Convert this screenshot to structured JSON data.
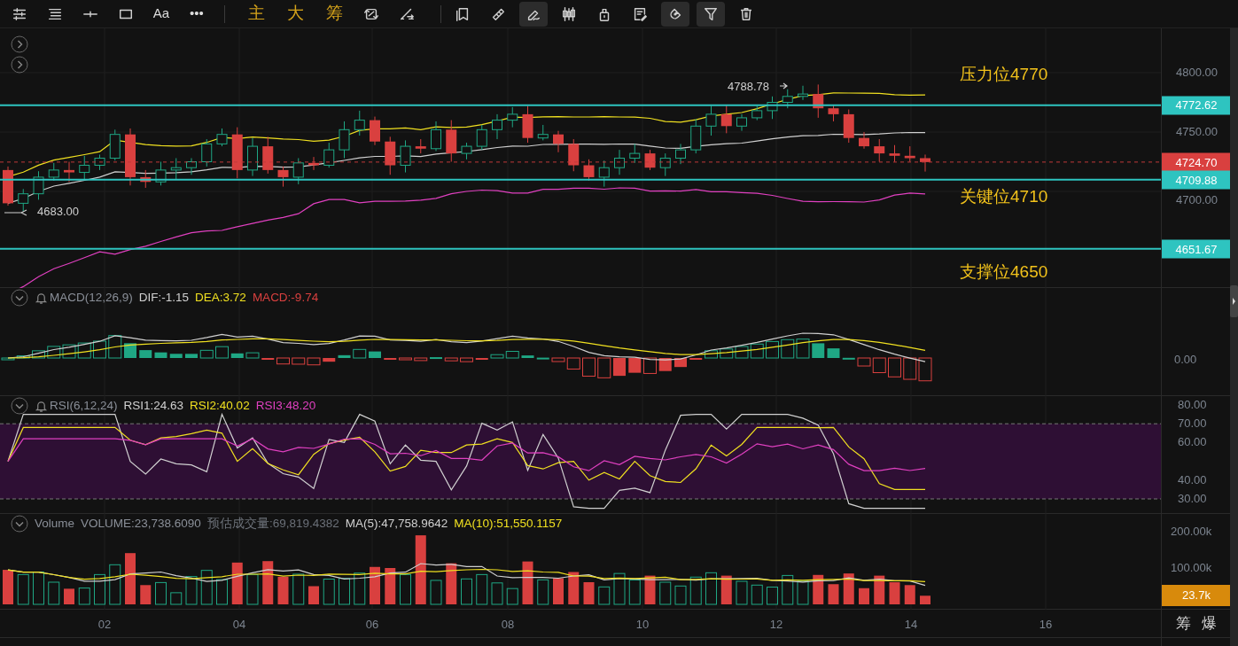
{
  "toolbar": [
    {
      "kind": "icon",
      "selected": false
    },
    {
      "kind": "icon",
      "selected": false
    },
    {
      "kind": "icon",
      "selected": false
    },
    {
      "kind": "icon",
      "selected": false
    },
    {
      "kind": "text",
      "label": "Aa",
      "selected": false
    },
    {
      "kind": "text",
      "label": "•••",
      "selected": false
    },
    {
      "kind": "glyph",
      "label": "主",
      "selected": false
    },
    {
      "kind": "glyph",
      "label": "大",
      "selected": false
    },
    {
      "kind": "glyph",
      "label": "筹",
      "selected": false
    },
    {
      "kind": "icon",
      "selected": false
    },
    {
      "kind": "icon",
      "selected": false
    },
    {
      "kind": "icon",
      "selected": false
    },
    {
      "kind": "icon",
      "selected": false
    },
    {
      "kind": "icon",
      "selected": true
    },
    {
      "kind": "icon",
      "selected": false
    },
    {
      "kind": "icon",
      "selected": false
    },
    {
      "kind": "icon",
      "selected": false
    },
    {
      "kind": "icon",
      "selected": true
    },
    {
      "kind": "icon",
      "selected": true
    },
    {
      "kind": "icon",
      "selected": false
    }
  ],
  "main_panel": {
    "annotations": [
      {
        "text": "压力位4770"
      },
      {
        "text": "关键位4710"
      },
      {
        "text": "支撑位4650"
      }
    ],
    "high_marker": "4788.78",
    "low_marker": "4683.00",
    "price_ticks": [
      "4800.00",
      "4750.00",
      "4700.00"
    ],
    "price_badges": [
      {
        "text": "4772.62",
        "color": "#2ec4c0"
      },
      {
        "text": "4724.70",
        "color": "#d9403f"
      },
      {
        "text": "4709.88",
        "color": "#2ec4c0"
      },
      {
        "text": "4651.67",
        "color": "#2ec4c0"
      }
    ]
  },
  "macd_panel": {
    "legend": [
      {
        "text": "MACD(12,26,9)",
        "color": "#8a8f98"
      },
      {
        "text": "DIF:-1.15",
        "color": "#d0d0d0"
      },
      {
        "text": "DEA:3.72",
        "color": "#f0e020"
      },
      {
        "text": "MACD:-9.74",
        "color": "#d9403f"
      }
    ],
    "ticks": [
      "0.00"
    ]
  },
  "rsi_panel": {
    "legend": [
      {
        "text": "RSI(6,12,24)",
        "color": "#8a8f98"
      },
      {
        "text": "RSI1:24.63",
        "color": "#d0d0d0"
      },
      {
        "text": "RSI2:40.02",
        "color": "#f0e020"
      },
      {
        "text": "RSI3:48.20",
        "color": "#e040c0"
      }
    ],
    "ticks": [
      "80.00",
      "70.00",
      "60.00",
      "40.00",
      "30.00"
    ]
  },
  "volume_panel": {
    "legend": [
      {
        "text": "Volume",
        "color": "#8a8f98"
      },
      {
        "text": "VOLUME:23,738.6090",
        "color": "#8a8f98"
      },
      {
        "text": "预估成交量:69,819.4382",
        "color": "#6b7078"
      },
      {
        "text": "MA(5):47,758.9642",
        "color": "#d0d0d0"
      },
      {
        "text": "MA(10):51,550.1157",
        "color": "#f0e020"
      }
    ],
    "ticks": [
      "200.00k",
      "100.00k"
    ],
    "badge": "23.7k"
  },
  "x_axis": [
    "02",
    "04",
    "06",
    "08",
    "10",
    "12",
    "14",
    "16"
  ],
  "corner_buttons": [
    "筹",
    "爆"
  ]
}
